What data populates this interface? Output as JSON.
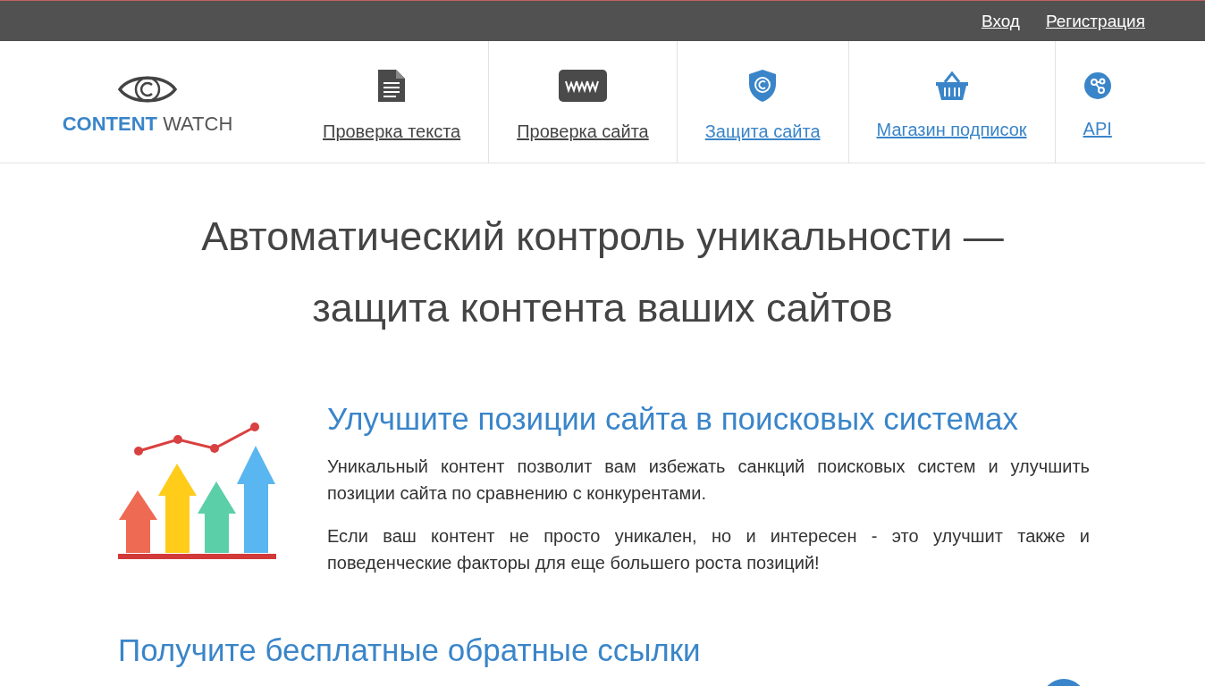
{
  "top_bar": {
    "links": [
      "Вход",
      "Регистрация"
    ]
  },
  "logo": {
    "word_1": "CONTENT",
    "word_2": "WATCH"
  },
  "nav": [
    {
      "label": "Проверка текста",
      "kind": "document",
      "color": "#444444"
    },
    {
      "label": "Проверка сайта",
      "kind": "www",
      "color": "#444444"
    },
    {
      "label": "Защита сайта",
      "kind": "shield",
      "color": "#3a85c9"
    },
    {
      "label": "Магазин подписок",
      "kind": "basket",
      "color": "#3a85c9"
    },
    {
      "label": "API",
      "kind": "api",
      "color": "#3a85c9"
    }
  ],
  "headline": "Автоматический контроль уникальности — защита контента ваших сайтов",
  "sections": [
    {
      "title": "Улучшите позиции сайта в поисковых системах",
      "paragraphs": [
        "Уникальный контент позволит вам избежать санкций поисковых систем и улучшить позиции сайта по сравнению с конкурентами.",
        "Если ваш контент не просто уникален, но и интересен - это улучшит также и поведенческие факторы для еще большего роста позиций!"
      ]
    }
  ],
  "next_section": {
    "title": "Получите бесплатные обратные ссылки"
  }
}
